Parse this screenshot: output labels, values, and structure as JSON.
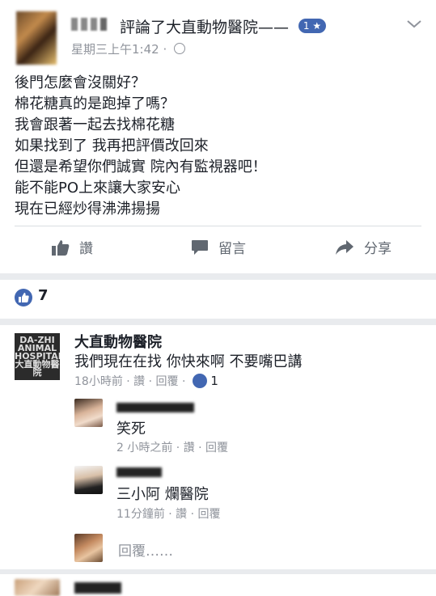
{
  "post": {
    "headline_suffix": "評論了大直動物醫院——",
    "rating_badge": "1 ★",
    "timestamp": "星期三上午1:42 ·",
    "body_lines": [
      "後門怎麼會沒關好？",
      "棉花糖真的是跑掉了嗎？",
      "我會跟著一起去找棉花糖",
      "如果找到了 我再把評價改回來",
      "但還是希望你們誠實 院內有監視器吧！",
      "能不能PO上來讓大家安心",
      "現在已經炒得沸沸揚揚"
    ],
    "actions": {
      "like": "讚",
      "comment": "留言",
      "share": "分享"
    }
  },
  "reactions": {
    "count": "7"
  },
  "comments": [
    {
      "name": "大直動物醫院",
      "text": "我們現在在找 你快來啊 不要嘴巴講",
      "meta": "18小時前 · 讚 · 回覆 ·",
      "likes": "1",
      "logo_text": "DA-ZHI ANIMAL HOSPITAL 大直動物醫院"
    },
    {
      "text": "笑死",
      "meta": "2 小時之前 · 讚 · 回覆"
    },
    {
      "text": "三小阿 爛醫院",
      "meta": "11分鐘前 · 讚 · 回覆"
    }
  ],
  "reply_placeholder": "回覆……",
  "colors": {
    "brand": "#4267b2",
    "meta_gray": "#90949c",
    "text": "#1d2129"
  }
}
